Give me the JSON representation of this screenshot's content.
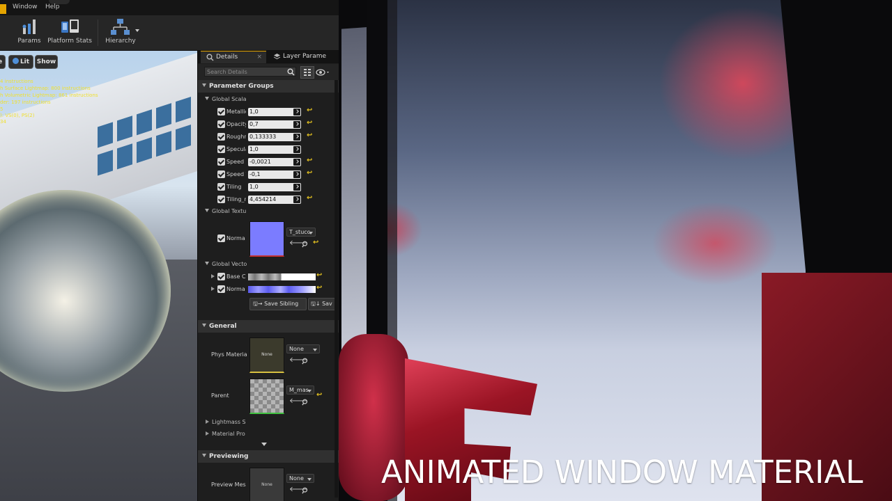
{
  "menu": {
    "items": [
      "Window",
      "Help"
    ]
  },
  "toolbar": {
    "buttons": [
      {
        "label": "Params",
        "icon": "params-icon"
      },
      {
        "label": "Platform Stats",
        "icon": "platform-stats-icon"
      },
      {
        "label": "Hierarchy",
        "icon": "hierarchy-icon"
      }
    ]
  },
  "viewport": {
    "buttons": {
      "lit": "Lit",
      "show": "Show"
    },
    "stats": [
      "4 instructions",
      "h Surface Lightmap: 800 instructions",
      "h Volumetric Lightmap: 861 instructions",
      "der: 197 instructions",
      "5",
      "): VS(0), PS(2)",
      "34"
    ]
  },
  "details": {
    "tabs": {
      "details": "Details",
      "layer": "Layer Parame"
    },
    "search_placeholder": "Search Details",
    "parameter_groups": "Parameter Groups",
    "global_scalar": "Global Scala",
    "scalars": [
      {
        "label": "Metallic",
        "value": "1,0",
        "reset": true
      },
      {
        "label": "Opacity",
        "value": "0,7",
        "reset": true
      },
      {
        "label": "Roughness",
        "value": "0,133333",
        "reset": true
      },
      {
        "label": "Specular",
        "value": "1,0",
        "reset": false
      },
      {
        "label": "Speed X",
        "value": "-0,0021",
        "reset": true
      },
      {
        "label": "Speed Y",
        "value": "-0,1",
        "reset": true
      },
      {
        "label": "Tiling",
        "value": "1,0",
        "reset": false
      },
      {
        "label": "Tiling_n",
        "value": "4,454214",
        "reset": true
      }
    ],
    "global_texture": "Global Textu",
    "normal_label": "Norma",
    "normal_texture": "T_stucc",
    "global_vector": "Global Vecto",
    "vectors": [
      {
        "label": "Base C"
      },
      {
        "label": "Norma"
      }
    ],
    "save_sibling": "Save Sibling",
    "save_child": "Sav",
    "general": "General",
    "phys_material_label": "Phys Materia",
    "phys_material_value": "None",
    "phys_thumb_text": "None",
    "parent_label": "Parent",
    "parent_value": "M_mas",
    "lightmass": "Lightmass S",
    "material_props": "Material Pro",
    "previewing": "Previewing",
    "preview_mesh_label": "Preview Mes",
    "preview_mesh_value": "None",
    "preview_thumb_text": "None"
  },
  "overlay": {
    "title": "ANIMATED WINDOW MATERIAL"
  },
  "colors": {
    "accent": "#e4a400",
    "reset_arrow": "#e2c020",
    "normal_swatch": "#7b7cff"
  }
}
